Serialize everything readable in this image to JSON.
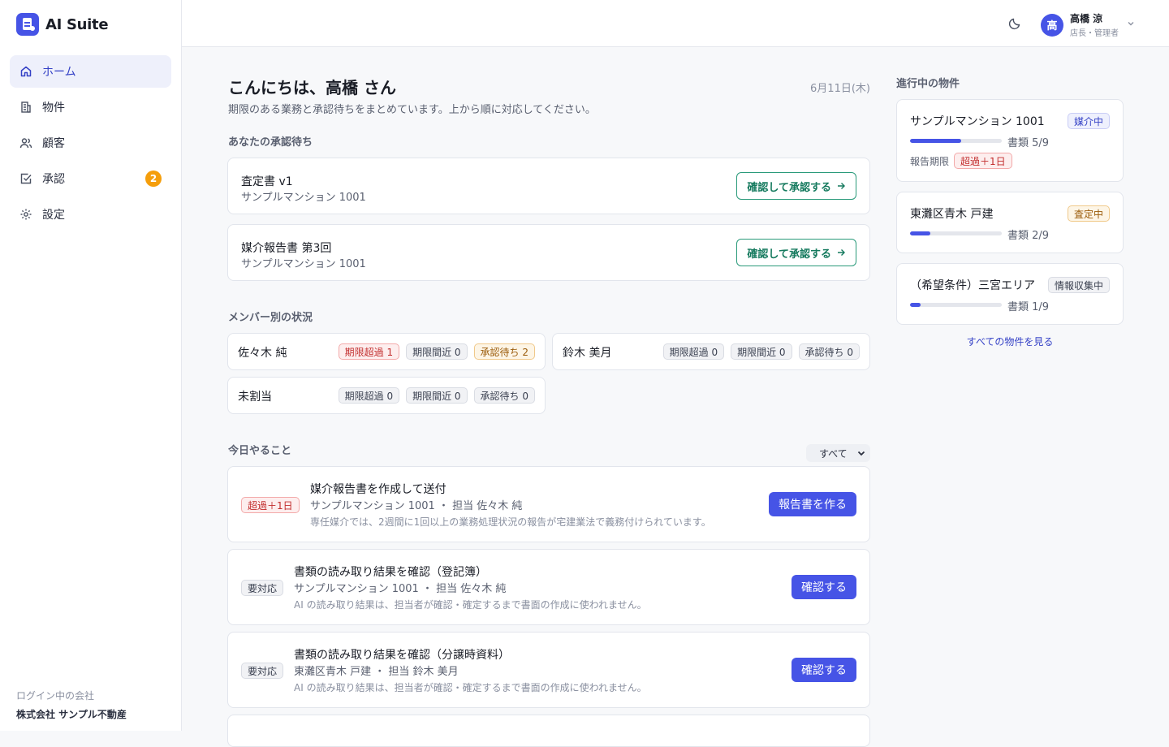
{
  "brand": {
    "name": "AI Suite"
  },
  "nav": [
    {
      "label": "ホーム",
      "icon": "home-icon",
      "active": true
    },
    {
      "label": "物件",
      "icon": "building-icon"
    },
    {
      "label": "顧客",
      "icon": "users-icon"
    },
    {
      "label": "承認",
      "icon": "check-square-icon",
      "badge": "2"
    },
    {
      "label": "設定",
      "icon": "gear-icon"
    }
  ],
  "company": {
    "label": "ログイン中の会社",
    "name": "株式会社 サンプル不動産"
  },
  "header": {
    "user": {
      "initial": "高",
      "name": "高橋 涼",
      "role": "店長・管理者"
    }
  },
  "main": {
    "greeting": "こんにちは、高橋 さん",
    "date": "6月11日(木)",
    "subtitle": "期限のある業務と承認待ちをまとめています。上から順に対応してください。",
    "approvals_title": "あなたの承認待ち",
    "approvals": [
      {
        "title": "査定書 v1",
        "property": "サンプルマンション 1001",
        "action": "確認して承認する"
      },
      {
        "title": "媒介報告書 第3回",
        "property": "サンプルマンション 1001",
        "action": "確認して承認する"
      }
    ],
    "members_title": "メンバー別の状況",
    "members": [
      {
        "name": "佐々木 純",
        "overdue": "期限超過 1",
        "near": "期限間近 0",
        "pending": "承認待ち 2"
      },
      {
        "name": "鈴木 美月",
        "overdue": "期限超過 0",
        "near": "期限間近 0",
        "pending": "承認待ち 0"
      },
      {
        "name": "未割当",
        "overdue": "期限超過 0",
        "near": "期限間近 0",
        "pending": "承認待ち 0"
      }
    ],
    "today_title": "今日やること",
    "filter": "すべて",
    "tasks": [
      {
        "chip": "超過＋1日",
        "title": "媒介報告書を作成して送付",
        "meta": "サンプルマンション 1001 ・ 担当 佐々木 純",
        "note": "専任媒介では、2週間に1回以上の業務処理状況の報告が宅建業法で義務付けられています。",
        "action": "報告書を作る"
      },
      {
        "chip": "要対応",
        "title": "書類の読み取り結果を確認（登記簿）",
        "meta": "サンプルマンション 1001 ・ 担当 佐々木 純",
        "note": "AI の読み取り結果は、担当者が確認・確定するまで書面の作成に使われません。",
        "action": "確認する"
      },
      {
        "chip": "要対応",
        "title": "書類の読み取り結果を確認（分譲時資料）",
        "meta": "東灘区青木 戸建 ・ 担当 鈴木 美月",
        "note": "AI の読み取り結果は、担当者が確認・確定するまで書面の作成に使われません。",
        "action": "確認する"
      }
    ]
  },
  "properties": {
    "title": "進行中の物件",
    "items": [
      {
        "name": "サンプルマンション 1001",
        "status": "媒介中",
        "docs": "書類 5/9",
        "progress": 0.5556,
        "deadline_label": "報告期限",
        "deadline": "超過＋1日"
      },
      {
        "name": "東灘区青木 戸建",
        "status": "査定中",
        "docs": "書類 2/9",
        "progress": 0.2222
      },
      {
        "name": "（希望条件）三宮エリア",
        "status": "情報収集中",
        "docs": "書類 1/9",
        "progress": 0.1111
      }
    ],
    "see_all": "すべての物件を見る"
  },
  "colors": {
    "accent": "#4654e6",
    "success": "#157a5e",
    "danger": "#c22d2d",
    "warning": "#f59e0b"
  }
}
